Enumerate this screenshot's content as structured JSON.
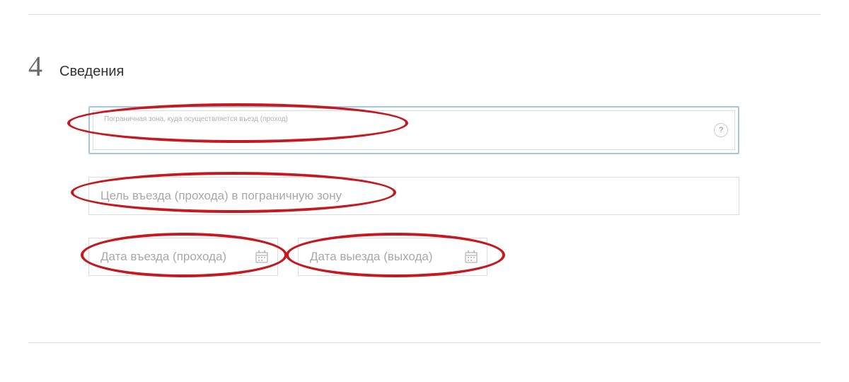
{
  "section": {
    "step_number": "4",
    "title": "Сведения"
  },
  "fields": {
    "border_zone": {
      "label": "Пограничная зона, куда осуществляется въезд (проход)",
      "value": "",
      "help": "?"
    },
    "purpose": {
      "placeholder": "Цель въезда (прохода) в пограничную зону",
      "value": ""
    },
    "entry_date": {
      "placeholder": "Дата въезда (прохода)",
      "value": ""
    },
    "exit_date": {
      "placeholder": "Дата выезда (выхода)",
      "value": ""
    }
  }
}
